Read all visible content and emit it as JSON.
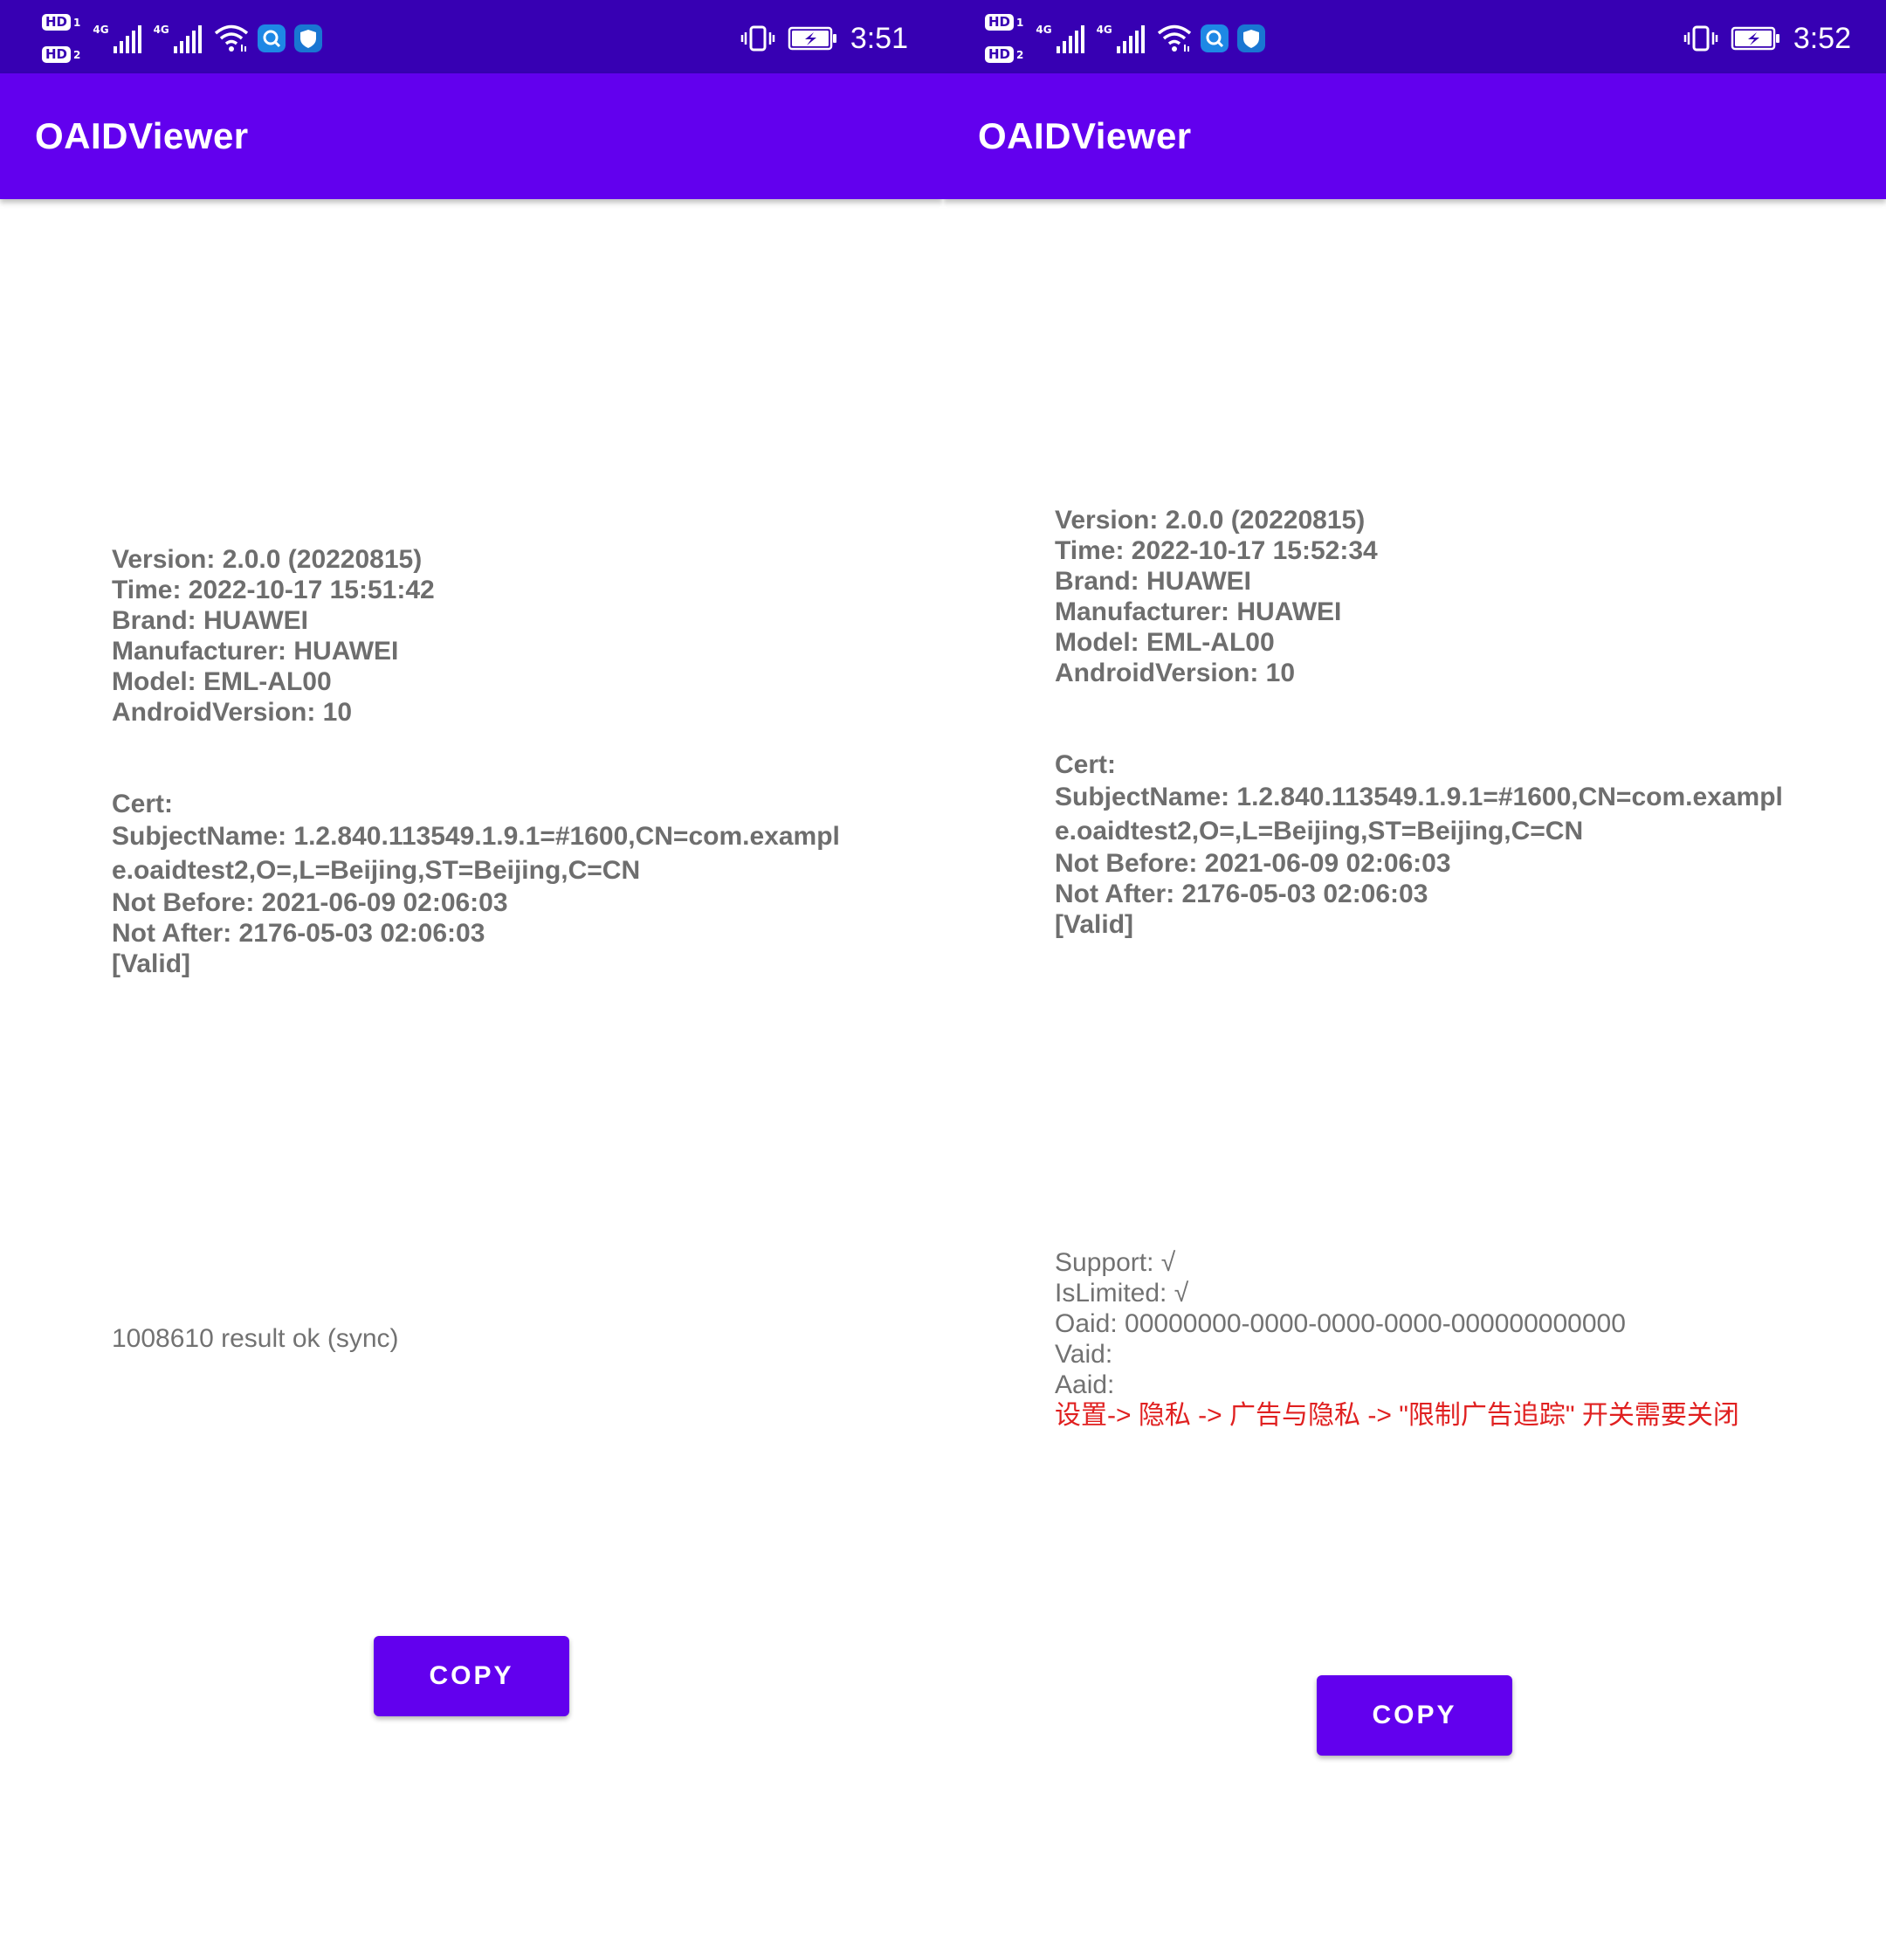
{
  "screens": [
    {
      "status": {
        "sim1": "HD",
        "sim1_num": "1",
        "sim2": "HD",
        "sim2_num": "2",
        "net1": "4G",
        "net2": "4G",
        "time": "3:51",
        "icons": [
          "signal-icon",
          "wifi-icon",
          "search-app-icon",
          "shield-app-icon",
          "vibrate-icon",
          "battery-charging-icon"
        ]
      },
      "app_title": "OAIDViewer",
      "info": {
        "version": "Version: 2.0.0 (20220815)",
        "time": "Time: 2022-10-17 15:51:42",
        "brand": "Brand: HUAWEI",
        "manufacturer": "Manufacturer: HUAWEI",
        "model": "Model: EML-AL00",
        "android": "AndroidVersion: 10"
      },
      "cert": {
        "label": "Cert:",
        "subject_1": "SubjectName: 1.2.840.113549.1.9.1=#1600,CN=com.exampl",
        "subject_2": "e.oaidtest2,O=,L=Beijing,ST=Beijing,C=CN",
        "not_before": "Not Before: 2021-06-09 02:06:03",
        "not_after": "Not After: 2176-05-03 02:06:03",
        "valid": "[Valid]"
      },
      "result": "1008610 result ok (sync)",
      "copy_label": "COPY"
    },
    {
      "status": {
        "sim1": "HD",
        "sim1_num": "1",
        "sim2": "HD",
        "sim2_num": "2",
        "net1": "4G",
        "net2": "4G",
        "time": "3:52",
        "icons": [
          "signal-icon",
          "wifi-icon",
          "search-app-icon",
          "shield-app-icon",
          "vibrate-icon",
          "battery-charging-icon"
        ]
      },
      "app_title": "OAIDViewer",
      "info": {
        "version": "Version: 2.0.0 (20220815)",
        "time": "Time: 2022-10-17 15:52:34",
        "brand": "Brand: HUAWEI",
        "manufacturer": "Manufacturer: HUAWEI",
        "model": "Model: EML-AL00",
        "android": "AndroidVersion: 10"
      },
      "cert": {
        "label": "Cert:",
        "subject_1": "SubjectName: 1.2.840.113549.1.9.1=#1600,CN=com.exampl",
        "subject_2": "e.oaidtest2,O=,L=Beijing,ST=Beijing,C=CN",
        "not_before": "Not Before: 2021-06-09 02:06:03",
        "not_after": "Not After: 2176-05-03 02:06:03",
        "valid": "[Valid]"
      },
      "result_lines": {
        "support": "Support: √",
        "islimited": "IsLimited: √",
        "oaid": "Oaid: 00000000-0000-0000-0000-000000000000",
        "vaid": "Vaid:",
        "aaid": "Aaid:",
        "hint": "设置-> 隐私 -> 广告与隐私 -> \"限制广告追踪\" 开关需要关闭"
      },
      "copy_label": "COPY"
    }
  ],
  "colors": {
    "status_bar": "#3700b3",
    "app_bar": "#6200ee",
    "button": "#6200ee",
    "text_gray": "#6e6e6e",
    "warning_red": "#e02020",
    "search_app": "#1e88e5",
    "shield_app": "#1976d2"
  }
}
